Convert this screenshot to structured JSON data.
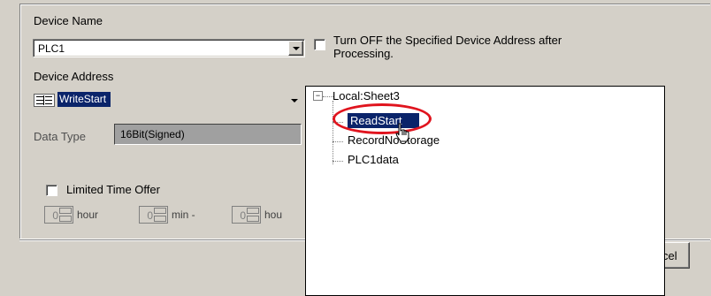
{
  "device_name": {
    "label": "Device Name",
    "value": "PLC1"
  },
  "turn_off_option": {
    "line1": "Turn OFF the Specified Device Address after",
    "line2": "Processing.",
    "checked": false
  },
  "device_address": {
    "label": "Device Address",
    "value": "WriteStart"
  },
  "data_type": {
    "label": "Data Type",
    "value": "16Bit(Signed)"
  },
  "limited_time": {
    "label": "Limited Time Offer",
    "checked": false,
    "hour_value": "0",
    "hour_label": "hour",
    "min_value": "0",
    "min_label": "min -",
    "second_value": "0",
    "second_label_partial": "hou"
  },
  "tree": {
    "root": "Local:Sheet3",
    "root_toggle": "⊟",
    "items": [
      "ReadStart",
      "RecordNoStorage",
      "PLC1data"
    ],
    "selected_index": 0
  },
  "cancel_button_partial": "cel",
  "colors": {
    "face": "#d4d0c8",
    "selection": "#0a246a",
    "highlight_circle": "#e0141e"
  }
}
